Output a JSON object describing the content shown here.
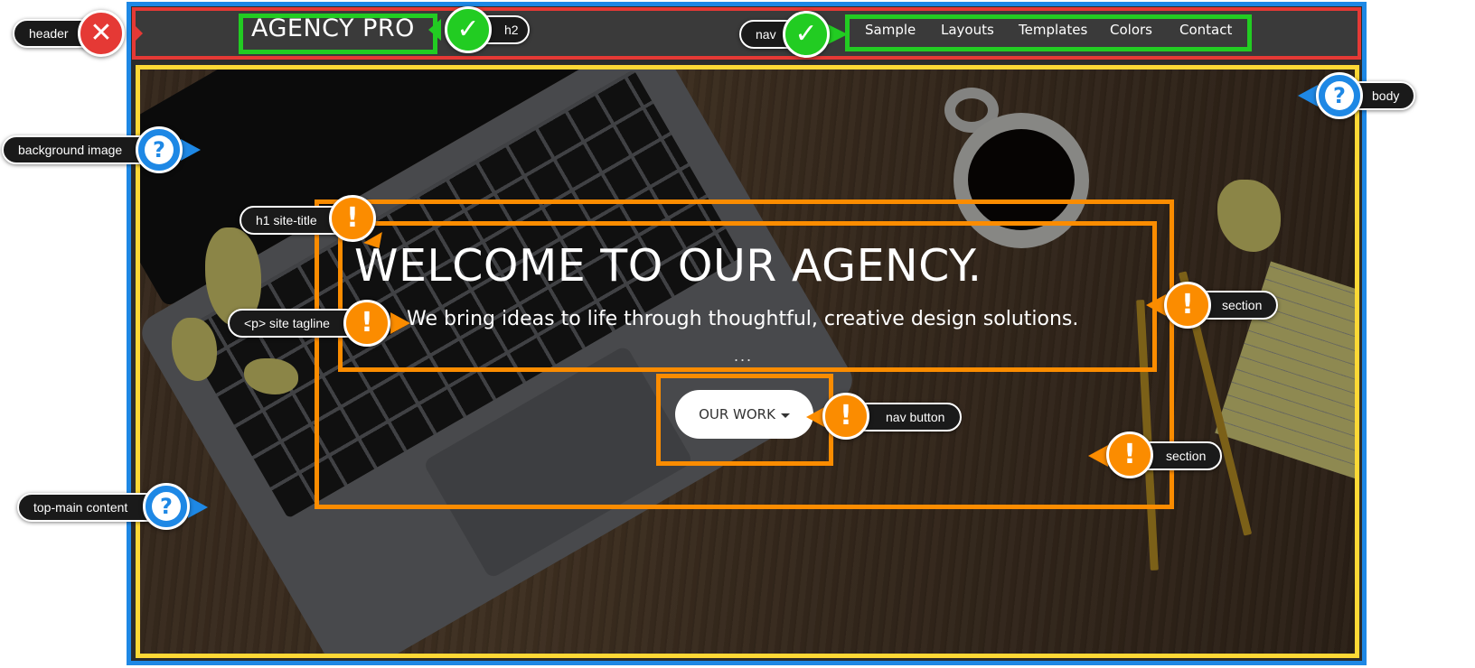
{
  "page": {
    "logo": "AGENCY PRO",
    "nav_links": [
      "Sample",
      "Layouts",
      "Templates",
      "Colors",
      "Contact"
    ],
    "hero_title": "WELCOME TO OUR AGENCY.",
    "hero_tagline": "We bring ideas to life through thoughtful, creative design solutions.",
    "hero_dots": "...",
    "cta_label": "OUR WORK"
  },
  "callouts": {
    "header": "header",
    "h2": "h2",
    "nav": "nav",
    "body": "body",
    "background_image": "background image",
    "h1_site_title": "h1 site-title",
    "site_tagline": "<p> site tagline",
    "nav_button": "nav button",
    "section_upper": "section",
    "section_lower": "section",
    "top_main_content": "top-main content"
  },
  "colors": {
    "error": "#e53935",
    "ok": "#22cc22",
    "warning": "#fb8c00",
    "info": "#1e88e5",
    "main_content": "#fdd835"
  },
  "icons": {
    "error": "cross",
    "ok": "check",
    "warning": "exclamation",
    "info": "question"
  }
}
